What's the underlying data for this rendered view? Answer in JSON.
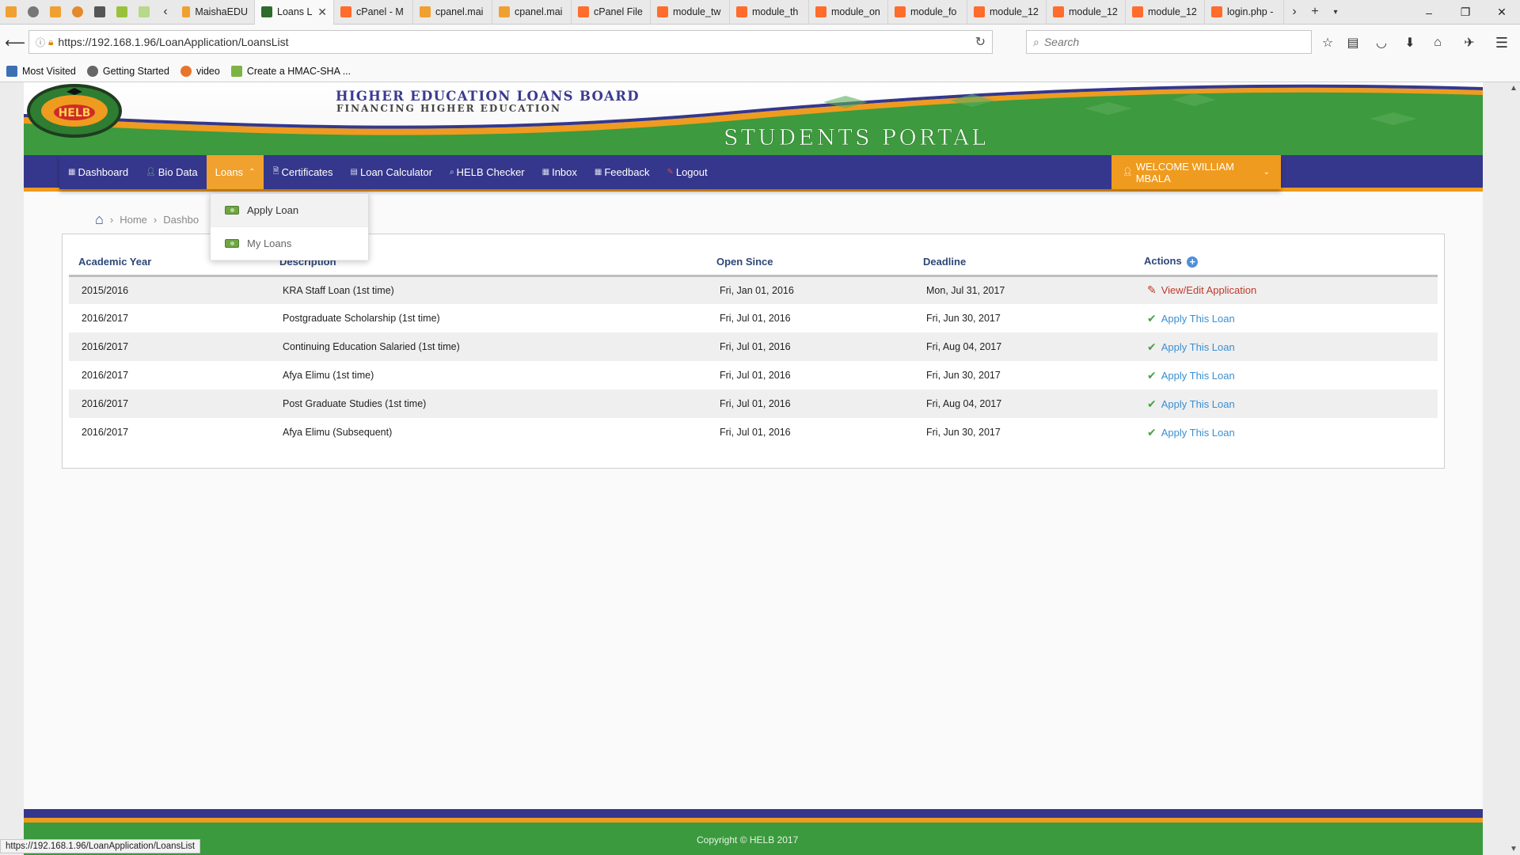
{
  "browser": {
    "tabs": [
      {
        "label": "MaishaEDU",
        "icon_color": "#f0a030"
      },
      {
        "label": "Loans L",
        "icon_color": "#2e6b2e",
        "active": true
      },
      {
        "label": "cPanel - M",
        "icon_color": "#ff6c2c"
      },
      {
        "label": "cpanel.mai",
        "icon_color": "#f0a030"
      },
      {
        "label": "cpanel.mai",
        "icon_color": "#f0a030"
      },
      {
        "label": "cPanel File",
        "icon_color": "#ff6c2c"
      },
      {
        "label": "module_tw",
        "icon_color": "#ff6c2c"
      },
      {
        "label": "module_th",
        "icon_color": "#ff6c2c"
      },
      {
        "label": "module_on",
        "icon_color": "#ff6c2c"
      },
      {
        "label": "module_fo",
        "icon_color": "#ff6c2c"
      },
      {
        "label": "module_12",
        "icon_color": "#ff6c2c"
      },
      {
        "label": "module_12",
        "icon_color": "#ff6c2c"
      },
      {
        "label": "module_12",
        "icon_color": "#ff6c2c"
      },
      {
        "label": "login.php -",
        "icon_color": "#ff6c2c"
      }
    ],
    "url": "https://192.168.1.96/LoanApplication/LoansList",
    "search_placeholder": "Search",
    "bookmarks": [
      {
        "label": "Most Visited",
        "icon": "bookmark-icon"
      },
      {
        "label": "Getting Started",
        "icon": "firefox-icon"
      },
      {
        "label": "video",
        "icon": "video-icon"
      },
      {
        "label": "Create a HMAC-SHA ...",
        "icon": "page-icon"
      }
    ],
    "status_url": "https://192.168.1.96/LoanApplication/LoansList"
  },
  "header": {
    "logo_text": "HELB",
    "board_title": "HIGHER EDUCATION LOANS BOARD",
    "board_subtitle": "FINANCING HIGHER EDUCATION",
    "portal_title": "STUDENTS PORTAL"
  },
  "menu": {
    "items": [
      {
        "label": "Dashboard",
        "icon": "grid-icon"
      },
      {
        "label": "Bio Data",
        "icon": "user-icon"
      },
      {
        "label": "Loans",
        "icon": "chevron-up-icon",
        "active": true
      },
      {
        "label": "Certificates",
        "icon": "document-icon"
      },
      {
        "label": "Loan Calculator",
        "icon": "calculator-icon"
      },
      {
        "label": "HELB Checker",
        "icon": "search-icon"
      },
      {
        "label": "Inbox",
        "icon": "grid-icon"
      },
      {
        "label": "Feedback",
        "icon": "grid-icon"
      },
      {
        "label": "Logout",
        "icon": "pencil-icon"
      }
    ],
    "welcome": "WELCOME WILLIAM MBALA",
    "loans_dropdown": [
      {
        "label": "Apply Loan"
      },
      {
        "label": "My Loans"
      }
    ]
  },
  "breadcrumb": {
    "home": "Home",
    "current": "Dashbo"
  },
  "table": {
    "headers": [
      "Academic Year",
      "Description",
      "Open Since",
      "Deadline",
      "Actions"
    ],
    "rows": [
      {
        "year": "2015/2016",
        "description": "KRA Staff Loan (1st time)",
        "open_since": "Fri, Jan 01, 2016",
        "deadline": "Mon, Jul 31, 2017",
        "action": "View/Edit  Application",
        "action_type": "edit"
      },
      {
        "year": "2016/2017",
        "description": "Postgraduate Scholarship (1st time)",
        "open_since": "Fri, Jul 01, 2016",
        "deadline": "Fri, Jun 30, 2017",
        "action": "Apply This Loan",
        "action_type": "apply"
      },
      {
        "year": "2016/2017",
        "description": "Continuing Education Salaried (1st time)",
        "open_since": "Fri, Jul 01, 2016",
        "deadline": "Fri, Aug 04, 2017",
        "action": "Apply This Loan",
        "action_type": "apply"
      },
      {
        "year": "2016/2017",
        "description": "Afya Elimu (1st time)",
        "open_since": "Fri, Jul 01, 2016",
        "deadline": "Fri, Jun 30, 2017",
        "action": "Apply This Loan",
        "action_type": "apply"
      },
      {
        "year": "2016/2017",
        "description": "Post Graduate Studies (1st time)",
        "open_since": "Fri, Jul 01, 2016",
        "deadline": "Fri, Aug 04, 2017",
        "action": "Apply This Loan",
        "action_type": "apply"
      },
      {
        "year": "2016/2017",
        "description": "Afya Elimu (Subsequent)",
        "open_since": "Fri, Jul 01, 2016",
        "deadline": "Fri, Jun 30, 2017",
        "action": "Apply This Loan",
        "action_type": "apply"
      }
    ]
  },
  "footer": {
    "copyright": "Copyright © HELB 2017"
  },
  "colors": {
    "brand_blue": "#35378c",
    "brand_orange": "#ef9b1f",
    "brand_green": "#3a9a3d",
    "link_blue": "#3b8fd1",
    "edit_red": "#c0392b"
  }
}
